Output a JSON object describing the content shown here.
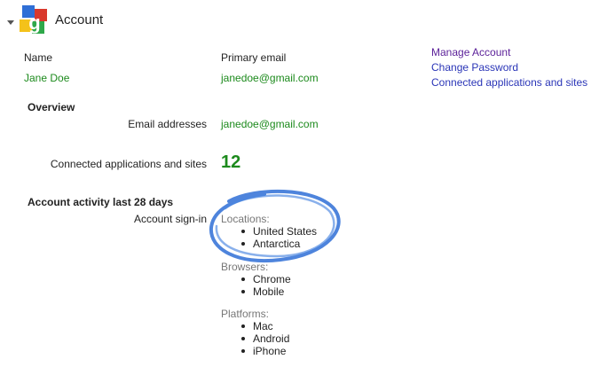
{
  "header": {
    "title": "Account"
  },
  "profile": {
    "name_label": "Name",
    "name_value": "Jane Doe",
    "email_label": "Primary email",
    "email_value": "janedoe@gmail.com"
  },
  "links": {
    "manage_account": "Manage Account",
    "change_password": "Change Password",
    "connected_apps": "Connected applications and sites"
  },
  "overview": {
    "heading": "Overview",
    "email_addresses_label": "Email addresses",
    "email_addresses_value": "janedoe@gmail.com",
    "connected_label": "Connected applications and sites",
    "connected_count": "12"
  },
  "activity": {
    "heading": "Account activity last 28 days",
    "signin_label": "Account sign-in",
    "locations_label": "Locations:",
    "locations": [
      "United States",
      "Antarctica"
    ],
    "browsers_label": "Browsers:",
    "browsers": [
      "Chrome",
      "Mobile"
    ],
    "platforms_label": "Platforms:",
    "platforms": [
      "Mac",
      "Android",
      "iPhone"
    ]
  },
  "colors": {
    "value_green": "#1c8a1c",
    "link_blue": "#2a35b7",
    "link_visited": "#5a1f98",
    "circle_blue": "#2f6fd6"
  }
}
